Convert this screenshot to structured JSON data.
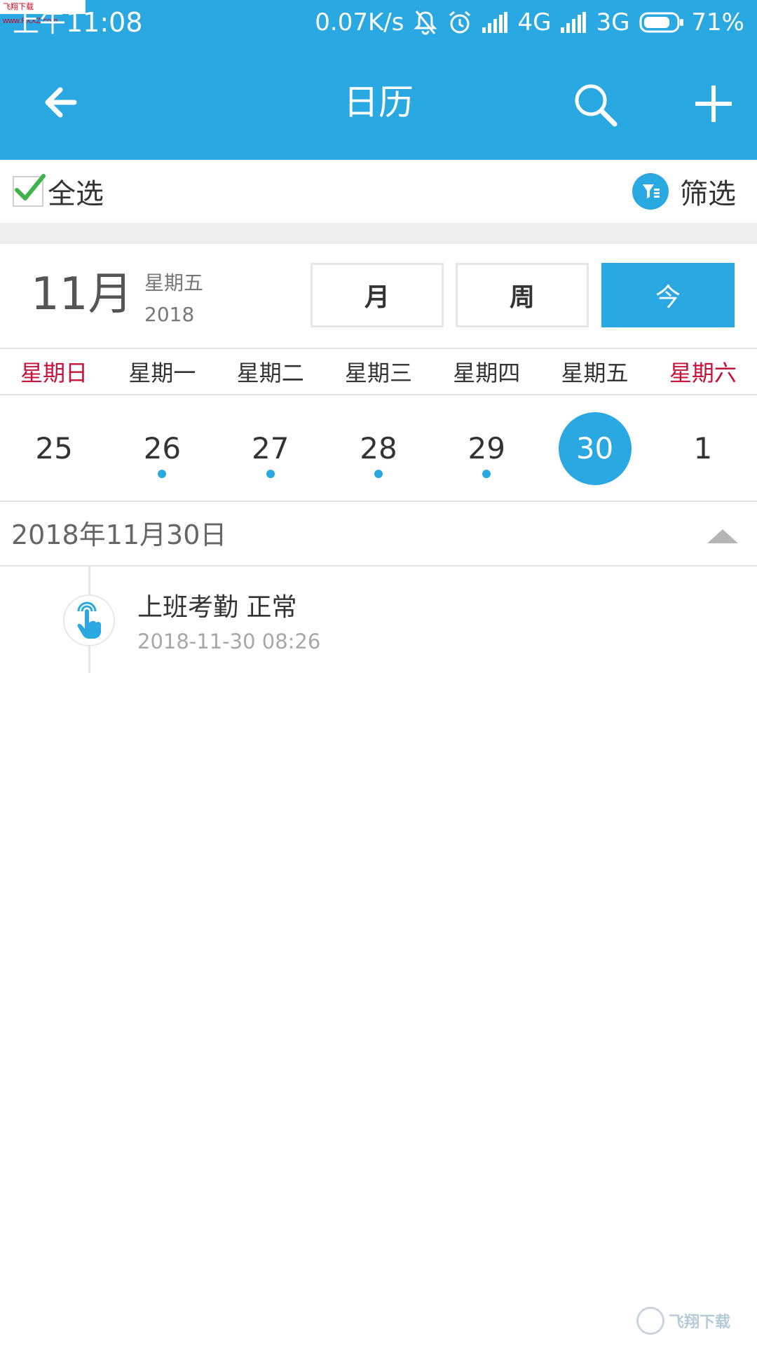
{
  "watermark_top": "飞翔下载 www.FXXZ.com",
  "status_bar": {
    "time": "上午11:08",
    "speed": "0.07K/s",
    "network1": "4G",
    "network2": "3G",
    "battery": "71%"
  },
  "app_bar": {
    "title": "日历"
  },
  "filter_row": {
    "select_all_label": "全选",
    "filter_label": "筛选"
  },
  "month_header": {
    "month": "11月",
    "weekday": "星期五",
    "year": "2018",
    "view_month_label": "月",
    "view_week_label": "周",
    "view_today_label": "今"
  },
  "weekdays": [
    "星期日",
    "星期一",
    "星期二",
    "星期三",
    "星期四",
    "星期五",
    "星期六"
  ],
  "days": [
    {
      "num": "25",
      "dot": false,
      "selected": false
    },
    {
      "num": "26",
      "dot": true,
      "selected": false
    },
    {
      "num": "27",
      "dot": true,
      "selected": false
    },
    {
      "num": "28",
      "dot": true,
      "selected": false
    },
    {
      "num": "29",
      "dot": true,
      "selected": false
    },
    {
      "num": "30",
      "dot": false,
      "selected": true
    },
    {
      "num": "1",
      "dot": false,
      "selected": false
    }
  ],
  "selected_date": {
    "label": "2018年11月30日"
  },
  "events": [
    {
      "title": "上班考勤 正常",
      "time": "2018-11-30 08:26",
      "icon": "touch-hand-icon"
    }
  ],
  "watermark_bottom": "飞翔下载",
  "colors": {
    "accent": "#29a8e2",
    "weekend": "#c4123a",
    "check": "#3cb44a"
  }
}
